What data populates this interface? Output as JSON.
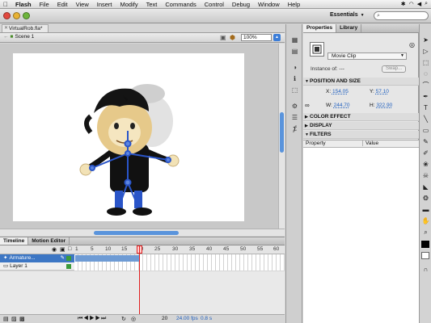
{
  "menubar": {
    "app": "Flash",
    "items": [
      "File",
      "Edit",
      "View",
      "Insert",
      "Modify",
      "Text",
      "Commands",
      "Control",
      "Debug",
      "Window",
      "Help"
    ]
  },
  "toolbar": {
    "workspace": "Essentials",
    "search_placeholder": ""
  },
  "document": {
    "tab_label": "VirtualRob.fla*",
    "scene": "Scene 1",
    "zoom": "100%"
  },
  "timeline": {
    "tabs": [
      "Timeline",
      "Motion Editor"
    ],
    "ruler": [
      "1",
      "5",
      "10",
      "15",
      "20",
      "25",
      "30",
      "35",
      "40",
      "45",
      "50",
      "55",
      "60"
    ],
    "layers": [
      {
        "name": "Armature..."
      },
      {
        "name": "Layer 1"
      }
    ],
    "current_frame": "20",
    "fps": "24.00 fps",
    "time": "0.8 s"
  },
  "properties": {
    "tabs": [
      "Properties",
      "Library"
    ],
    "symbol_type": "Movie Clip",
    "instance_label": "Instance of:",
    "instance_value": "---",
    "swap_label": "Swap...",
    "sections": {
      "position": "POSITION AND SIZE",
      "color": "COLOR EFFECT",
      "display": "DISPLAY",
      "filters": "FILTERS"
    },
    "x_label": "X:",
    "x": "154.05",
    "y_label": "Y:",
    "y": "57.10",
    "w_label": "W:",
    "w": "244.70",
    "h_label": "H:",
    "h": "322.90",
    "filter_columns": [
      "Property",
      "Value"
    ]
  },
  "colors": {
    "accent": "#3c76c4",
    "playhead": "#e02020",
    "bone": "#2a55c8"
  }
}
